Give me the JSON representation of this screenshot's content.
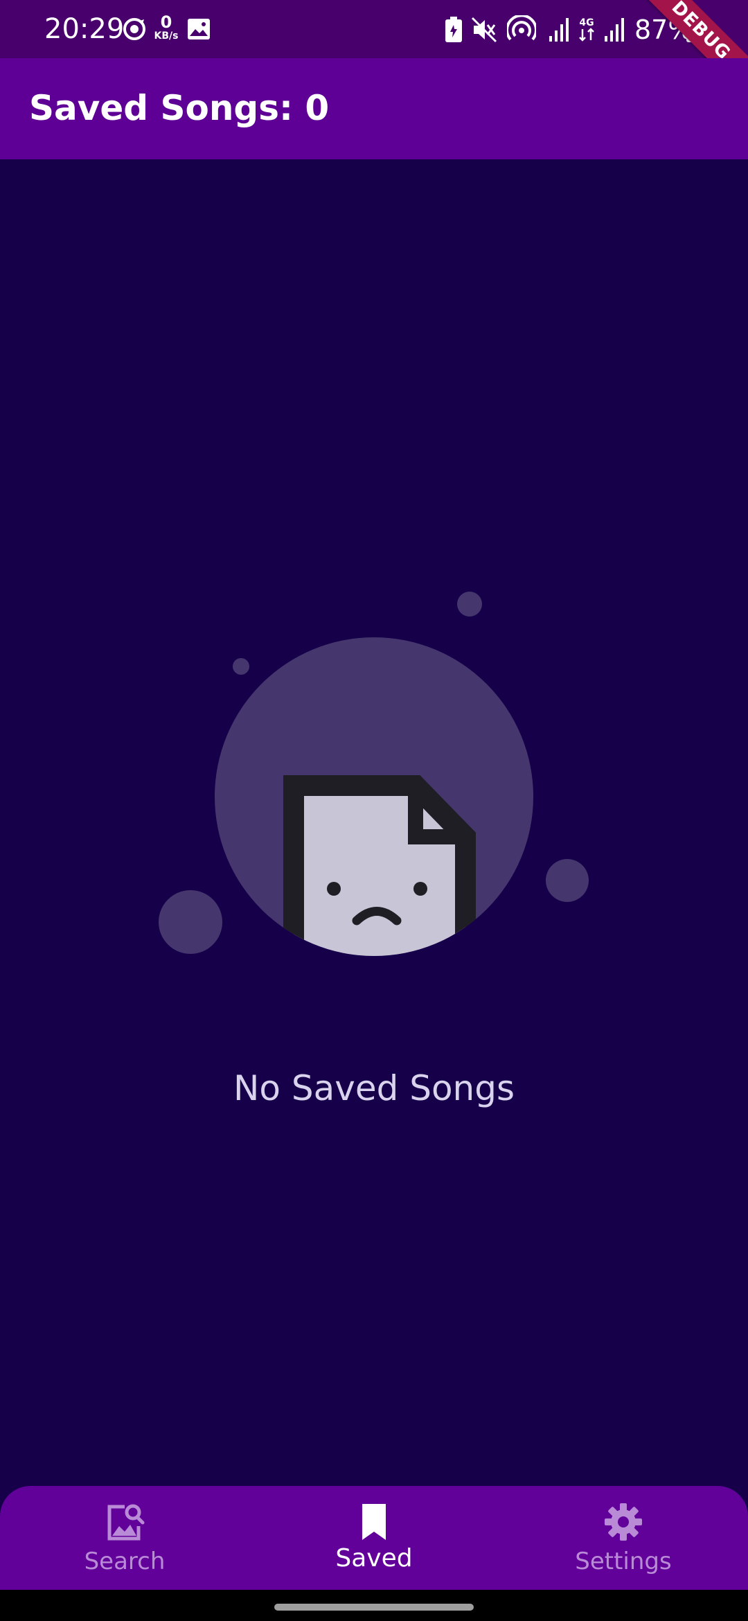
{
  "status_bar": {
    "time": "20:29",
    "netspeed_value": "0",
    "netspeed_unit": "KB/s",
    "battery": "87%",
    "icons": [
      "sync-icon",
      "image-icon",
      "battery-saver-icon",
      "mute-icon",
      "hotspot-icon",
      "signal-icon",
      "4g-icon",
      "signal-icon",
      "charging-icon"
    ]
  },
  "debug_banner": "DEBUG",
  "app_bar": {
    "title": "Saved Songs: 0"
  },
  "empty_state": {
    "message": "No Saved Songs"
  },
  "bottom_nav": {
    "items": [
      {
        "label": "Search",
        "icon": "image-search-icon",
        "active": false
      },
      {
        "label": "Saved",
        "icon": "bookmark-icon",
        "active": true
      },
      {
        "label": "Settings",
        "icon": "gear-icon",
        "active": false
      }
    ]
  },
  "colors": {
    "background": "#16004a",
    "app_bar": "#5e0096",
    "status_bar": "#48006c",
    "bottom_nav": "#62009a",
    "inactive_nav": "#b98ad6",
    "active_nav": "#ffffff"
  }
}
